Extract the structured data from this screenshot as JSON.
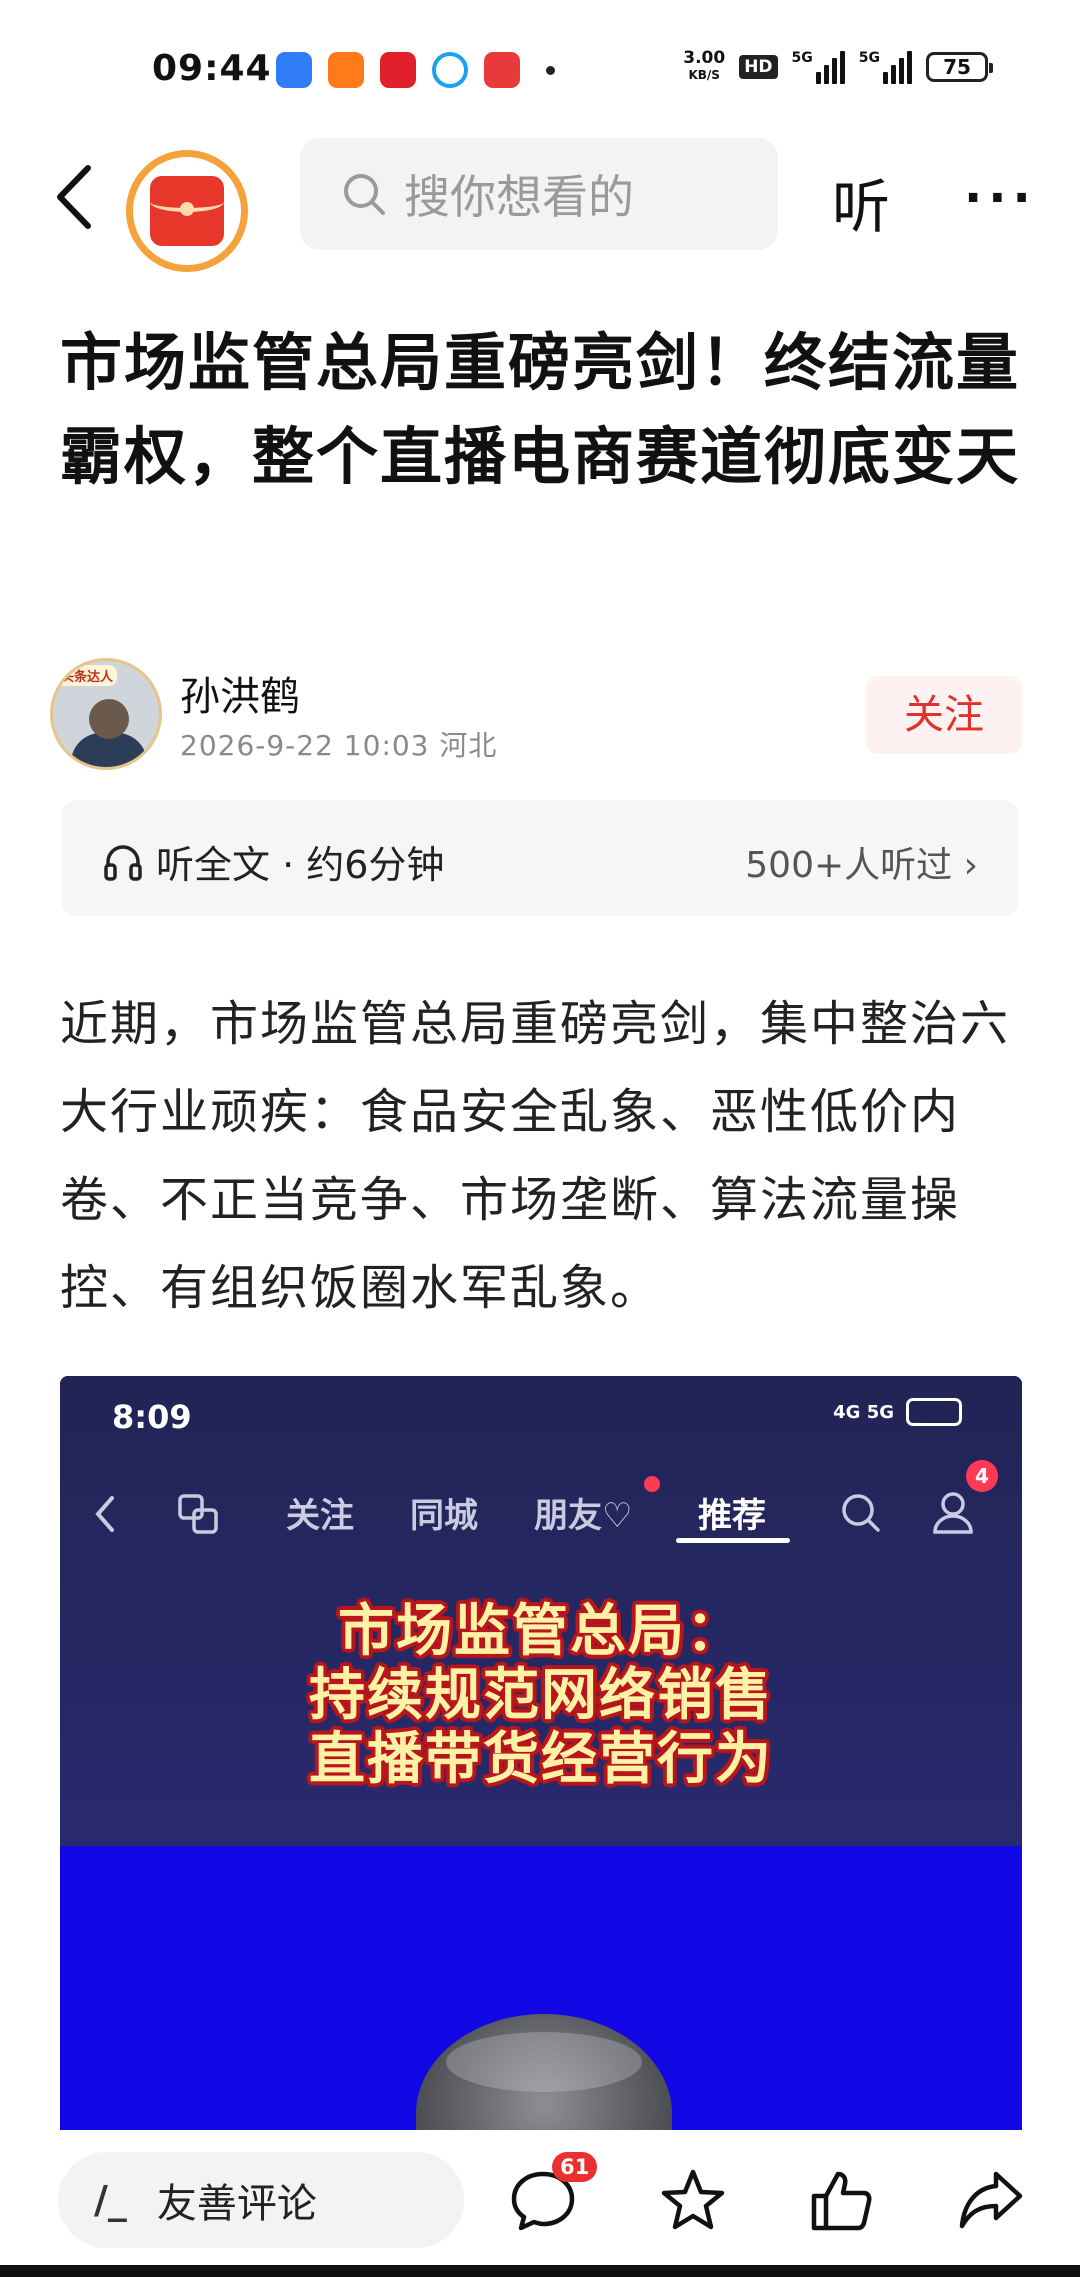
{
  "status_bar": {
    "time": "09:44",
    "speed_value": "3.00",
    "speed_unit": "KB/S",
    "hd_label": "HD",
    "signal_1_label": "5G",
    "signal_2_label": "5G",
    "battery": "75",
    "app_icon_colors": [
      "#2f7cf6",
      "#ff7a1a",
      "#e0202b",
      "#1aa2f0",
      "#e83a3a"
    ]
  },
  "nav": {
    "search_placeholder": "搜你想看的",
    "listen_label": "听",
    "more_label": "···"
  },
  "article": {
    "title": "市场监管总局重磅亮剑！终结流量霸权，整个直播电商赛道彻底变天",
    "author_name": "孙洪鹤",
    "author_badge": "头条达人",
    "author_meta": "2026-9-22  10:03  河北",
    "follow_label": "关注",
    "listen_full_text": "听全文 · 约6分钟",
    "listeners": "500+人听过 ›",
    "body": "近期，市场监管总局重磅亮剑，集中整治六大行业顽疾：食品安全乱象、恶性低价内卷、不正当竞争、市场垄断、算法流量操控、有组织饭圈水军乱象。"
  },
  "embedded": {
    "time": "8:09",
    "signal": "4G 5G",
    "tabs": [
      "关注",
      "同城",
      "朋友♡",
      "推荐"
    ],
    "notification_count": "4",
    "headline_lines": [
      "市场监管总局：",
      "持续规范网络销售",
      "直播带货经营行为"
    ]
  },
  "bottom_bar": {
    "comment_placeholder": "友善评论",
    "comment_count": "61"
  },
  "colors": {
    "accent_red": "#e0322b",
    "logo_ring": "#f5a23a",
    "embed_bg": "#222455",
    "embed_blue": "#1208e6"
  }
}
